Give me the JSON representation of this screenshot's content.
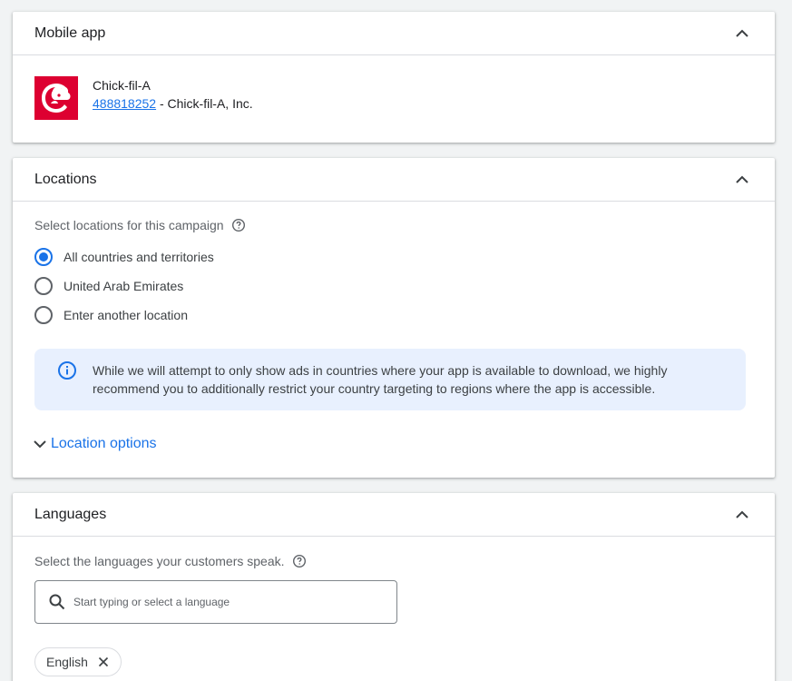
{
  "mobile_app": {
    "title": "Mobile app",
    "app_name": "Chick-fil-A",
    "app_id": "488818252",
    "publisher": " - Chick-fil-A, Inc.",
    "logo_icon": "chick-fil-a-logo",
    "logo_color": "#dd0031"
  },
  "locations": {
    "title": "Locations",
    "helper": "Select locations for this campaign",
    "options": [
      {
        "label": "All countries and territories",
        "checked": true
      },
      {
        "label": "United Arab Emirates",
        "checked": false
      },
      {
        "label": "Enter another location",
        "checked": false
      }
    ],
    "info_text": "While we will attempt to only show ads in countries where your app is available to download, we highly recommend you to additionally restrict your country targeting to regions where the app is accessible.",
    "location_options_label": "Location options"
  },
  "languages": {
    "title": "Languages",
    "helper": "Select the languages your customers speak.",
    "search_placeholder": "Start typing or select a language",
    "selected": [
      "English"
    ]
  },
  "colors": {
    "accent": "#1a73e8",
    "info_bg": "#e8f0fe"
  }
}
